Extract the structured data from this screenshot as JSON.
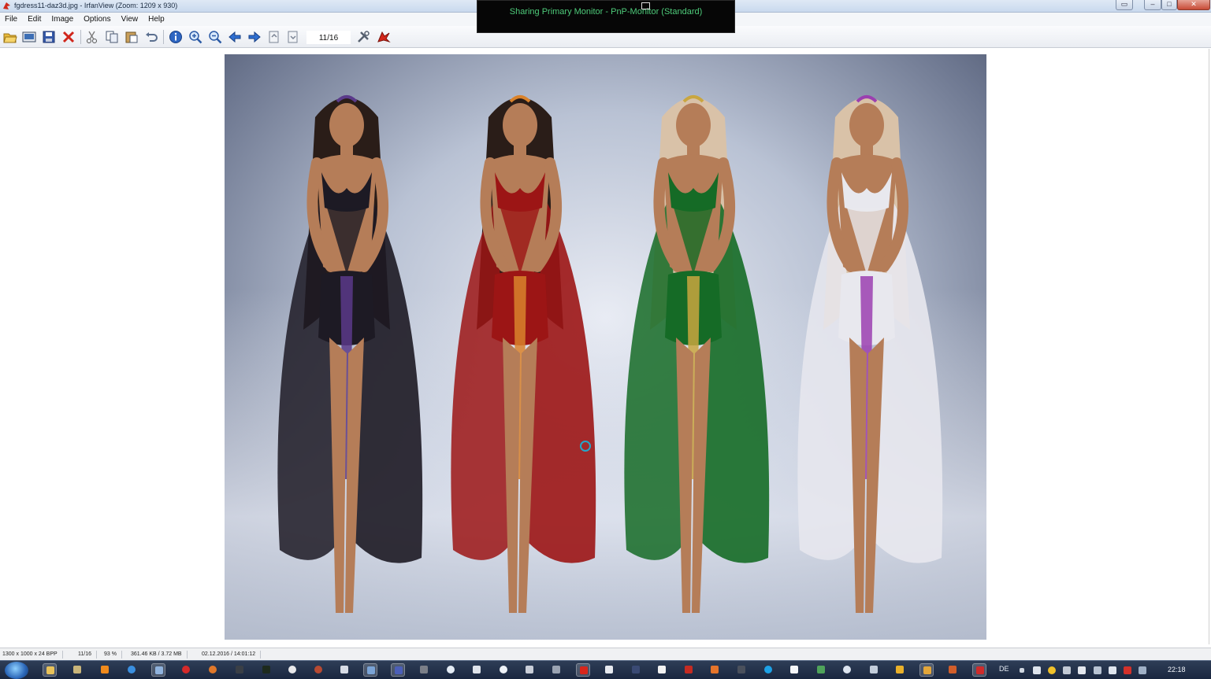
{
  "window": {
    "title": "fgdress11-daz3d.jpg - IrfanView (Zoom: 1209 x 930)"
  },
  "menu": [
    "File",
    "Edit",
    "Image",
    "Options",
    "View",
    "Help"
  ],
  "toolbar": {
    "page_indicator": "11/16",
    "buttons": [
      "open-icon",
      "slideshow-icon",
      "save-icon",
      "delete-icon",
      "cut-icon",
      "copy-icon",
      "paste-icon",
      "undo-icon",
      "info-icon",
      "zoom-in-icon",
      "zoom-out-icon",
      "previous-icon",
      "next-icon",
      "first-page-icon",
      "last-page-icon",
      "properties-icon",
      "about-icon"
    ]
  },
  "sharing_overlay": {
    "text": "Sharing Primary Monitor - PnP-Monitor (Standard)"
  },
  "image": {
    "figures": [
      {
        "dress_color": "#1d1a24",
        "accent": "#5a3a8a"
      },
      {
        "dress_color": "#9c1515",
        "accent": "#d9822b"
      },
      {
        "dress_color": "#156b26",
        "accent": "#c9a640"
      },
      {
        "dress_color": "#e8e8ee",
        "accent": "#9b3fb0"
      }
    ]
  },
  "status": {
    "dimensions": "1300 x 1000 x 24 BPP",
    "index": "11/16",
    "zoom": "93 %",
    "size": "361.46 KB / 3.72 MB",
    "datetime": "02.12.2016 / 14:01:12"
  },
  "taskbar": {
    "language": "DE",
    "clock": "22:18"
  }
}
